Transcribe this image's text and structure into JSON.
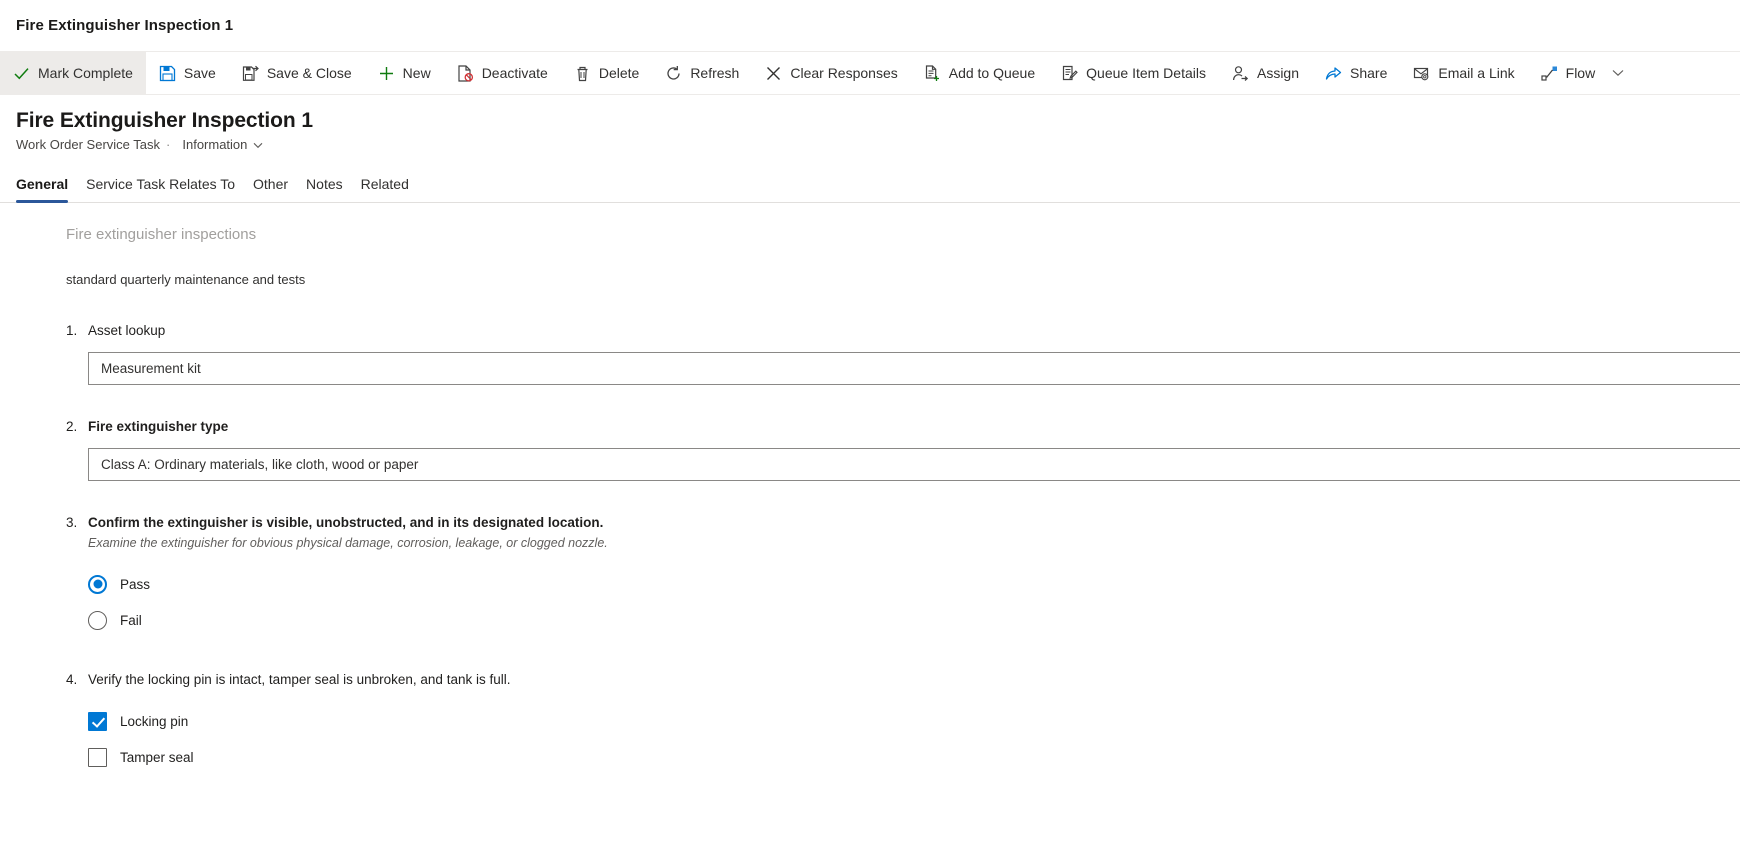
{
  "app": {
    "window_title": "Fire Extinguisher Inspection 1"
  },
  "commandbar": {
    "items": [
      {
        "label": "Mark Complete",
        "icon": "checkmark-icon",
        "active": true
      },
      {
        "label": "Save",
        "icon": "save-icon",
        "active": false
      },
      {
        "label": "Save & Close",
        "icon": "save-close-icon",
        "active": false
      },
      {
        "label": "New",
        "icon": "plus-icon",
        "active": false
      },
      {
        "label": "Deactivate",
        "icon": "deactivate-icon",
        "active": false
      },
      {
        "label": "Delete",
        "icon": "trash-icon",
        "active": false
      },
      {
        "label": "Refresh",
        "icon": "refresh-icon",
        "active": false
      },
      {
        "label": "Clear Responses",
        "icon": "close-x-icon",
        "active": false
      },
      {
        "label": "Add to Queue",
        "icon": "add-to-queue-icon",
        "active": false
      },
      {
        "label": "Queue Item Details",
        "icon": "queue-details-icon",
        "active": false
      },
      {
        "label": "Assign",
        "icon": "assign-user-icon",
        "active": false
      },
      {
        "label": "Share",
        "icon": "share-icon",
        "active": false
      },
      {
        "label": "Email a Link",
        "icon": "email-link-icon",
        "active": false
      },
      {
        "label": "Flow",
        "icon": "flow-icon",
        "active": false
      }
    ],
    "overflow_icon": "chevron-down-icon"
  },
  "record": {
    "title": "Fire Extinguisher Inspection 1",
    "entity": "Work Order Service Task",
    "separator": "·",
    "form_name": "Information",
    "form_chevron_icon": "chevron-down-icon"
  },
  "tabs": [
    {
      "label": "General",
      "selected": true
    },
    {
      "label": "Service Task Relates To",
      "selected": false
    },
    {
      "label": "Other",
      "selected": false
    },
    {
      "label": "Notes",
      "selected": false
    },
    {
      "label": "Related",
      "selected": false
    }
  ],
  "form": {
    "section_title": "Fire extinguisher inspections",
    "section_description": "standard quarterly maintenance and tests",
    "questions": [
      {
        "number": "1.",
        "label": "Asset lookup",
        "bold": false,
        "type": "lookup",
        "value": "Measurement kit"
      },
      {
        "number": "2.",
        "label": "Fire extinguisher type",
        "bold": true,
        "type": "text",
        "value": "Class A: Ordinary materials, like cloth, wood or paper"
      },
      {
        "number": "3.",
        "label": "Confirm the extinguisher is visible, unobstructed, and in its designated location.",
        "hint": "Examine the extinguisher for obvious physical damage, corrosion, leakage, or clogged nozzle.",
        "bold": true,
        "type": "radio",
        "options": [
          {
            "label": "Pass",
            "checked": true
          },
          {
            "label": "Fail",
            "checked": false
          }
        ]
      },
      {
        "number": "4.",
        "label": "Verify the locking pin is intact, tamper seal is unbroken, and tank is full.",
        "bold": false,
        "type": "checkbox",
        "options": [
          {
            "label": "Locking pin",
            "checked": true
          },
          {
            "label": "Tamper seal",
            "checked": false
          }
        ]
      }
    ]
  },
  "colors": {
    "accent": "#0078d4",
    "tab_underline": "#2b579a",
    "checkmark_green": "#107c10",
    "text_primary": "#201f1e",
    "text_secondary": "#605e5c"
  }
}
